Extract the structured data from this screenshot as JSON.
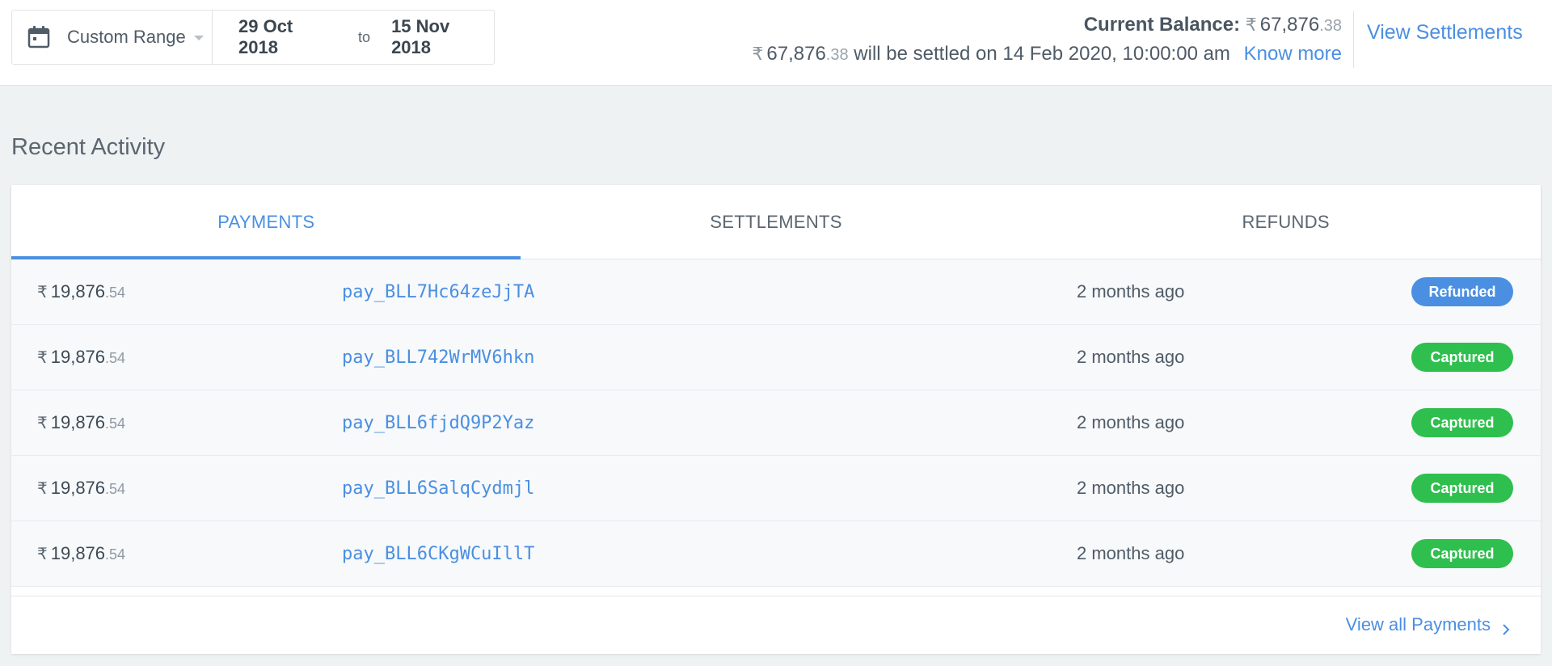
{
  "date_range": {
    "preset_label": "Custom Range",
    "from": "29 Oct 2018",
    "separator": "to",
    "to": "15 Nov 2018"
  },
  "balance": {
    "label": "Current Balance:",
    "currency_symbol": "₹",
    "amount_main": "67,876",
    "amount_paise": ".38",
    "settle_text": "will be settled on 14 Feb 2020, 10:00:00 am",
    "know_more": "Know more"
  },
  "view_settlements": "View Settlements",
  "recent_activity": {
    "title": "Recent Activity",
    "tabs": [
      {
        "label": "PAYMENTS",
        "active": true
      },
      {
        "label": "SETTLEMENTS",
        "active": false
      },
      {
        "label": "REFUNDS",
        "active": false
      }
    ],
    "rows": [
      {
        "currency": "₹",
        "amount": "19,876",
        "paise": ".54",
        "id": "pay_BLL7Hc64zeJjTA",
        "time": "2 months ago",
        "status": "Refunded",
        "status_color": "#4a8fe2"
      },
      {
        "currency": "₹",
        "amount": "19,876",
        "paise": ".54",
        "id": "pay_BLL742WrMV6hkn",
        "time": "2 months ago",
        "status": "Captured",
        "status_color": "#2fbf4e"
      },
      {
        "currency": "₹",
        "amount": "19,876",
        "paise": ".54",
        "id": "pay_BLL6fjdQ9P2Yaz",
        "time": "2 months ago",
        "status": "Captured",
        "status_color": "#2fbf4e"
      },
      {
        "currency": "₹",
        "amount": "19,876",
        "paise": ".54",
        "id": "pay_BLL6SalqCydmjl",
        "time": "2 months ago",
        "status": "Captured",
        "status_color": "#2fbf4e"
      },
      {
        "currency": "₹",
        "amount": "19,876",
        "paise": ".54",
        "id": "pay_BLL6CKgWCuIllT",
        "time": "2 months ago",
        "status": "Captured",
        "status_color": "#2fbf4e"
      }
    ],
    "view_all": "View all Payments"
  },
  "colors": {
    "accent": "#4a8fe2",
    "captured": "#2fbf4e",
    "refunded": "#4a8fe2"
  }
}
